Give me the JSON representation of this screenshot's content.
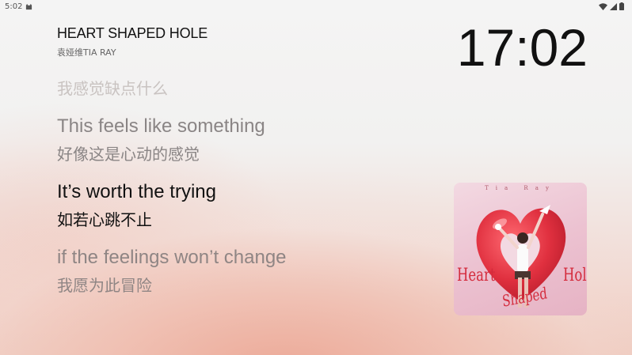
{
  "status_bar": {
    "time": "5:02",
    "icons": [
      "cat-notification-icon",
      "wifi-icon",
      "signal-icon",
      "battery-icon"
    ]
  },
  "now_playing": {
    "title": "HEART SHAPED HOLE",
    "artist": "袁娅维TIA RAY"
  },
  "clock": "17:02",
  "lyrics": {
    "previous_zh": "我感觉缺点什么",
    "before": {
      "en": "This feels like something",
      "zh": "好像这是心动的感觉"
    },
    "current": {
      "en": "It’s worth the trying",
      "zh": "如若心跳不止"
    },
    "next": {
      "en": "if the feelings won’t change",
      "zh": "我愿为此冒险"
    }
  },
  "album_art": {
    "top_text": "Tia Ray",
    "left_text": "Heart",
    "mid_text": "Shaped",
    "right_text": "Hole"
  },
  "colors": {
    "current_lyric": "#111111",
    "inactive_lyric": "#8a8585",
    "faded_lyric": "#c9c3c1",
    "accent_heart": "#e0303f"
  }
}
